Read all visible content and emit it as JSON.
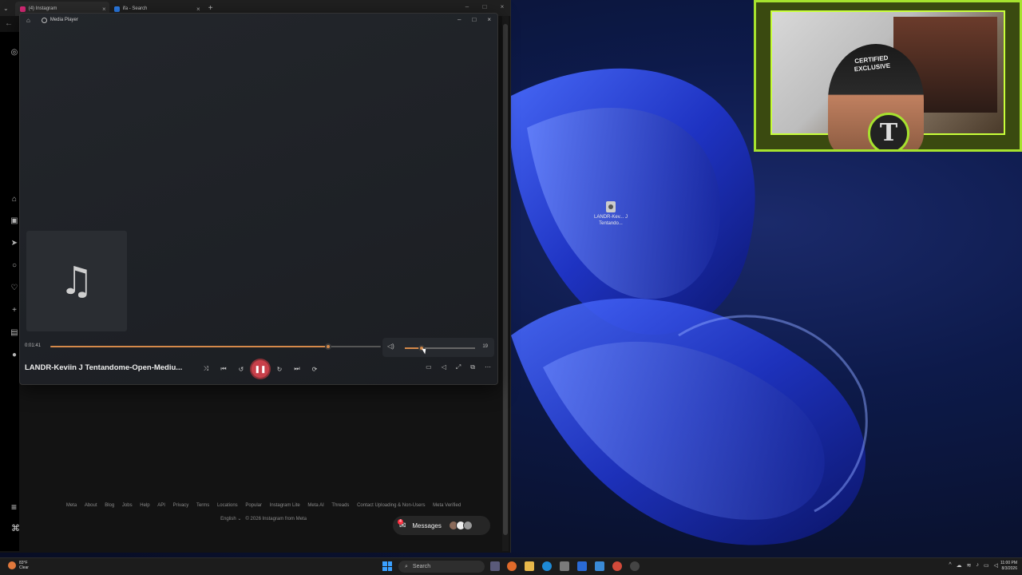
{
  "browser": {
    "tabs": [
      {
        "label": "(4) Instagram",
        "fav_color": "#d62976"
      },
      {
        "label": "ifa - Search",
        "fav_color": "#2b7de9"
      }
    ]
  },
  "player": {
    "app_title": "Media Player",
    "elapsed": "0:01:41",
    "progress_fraction": 0.84,
    "volume_fraction": 0.24,
    "volume_value": "19",
    "track_title": "LANDR-Keviin J Tentandome-Open-Mediu...",
    "art_icon": "music-note-icon"
  },
  "instagram_footer": {
    "links": [
      "Meta",
      "About",
      "Blog",
      "Jobs",
      "Help",
      "API",
      "Privacy",
      "Terms",
      "Locations",
      "Popular",
      "Instagram Lite",
      "Meta AI",
      "Threads",
      "Contact Uploading & Non-Users",
      "Meta Verified"
    ],
    "language": "English",
    "copyright": "© 2026 Instagram from Meta"
  },
  "messages": {
    "label": "Messages",
    "badge": "4"
  },
  "webcam": {
    "hat_text": "CERTIFIED EXCLUSIVE",
    "emblem": "T"
  },
  "desktop_icon": {
    "label": "LANDR-Kev... J Tentando..."
  },
  "taskbar": {
    "weather_temp": "83°F",
    "weather_desc": "Clear",
    "search_placeholder": "Search",
    "time": "11:00 PM",
    "date": "8/3/2026"
  },
  "colors": {
    "accent": "#d4894a",
    "play_button": "#c8404a",
    "webcam_frame": "#a6e22e"
  }
}
